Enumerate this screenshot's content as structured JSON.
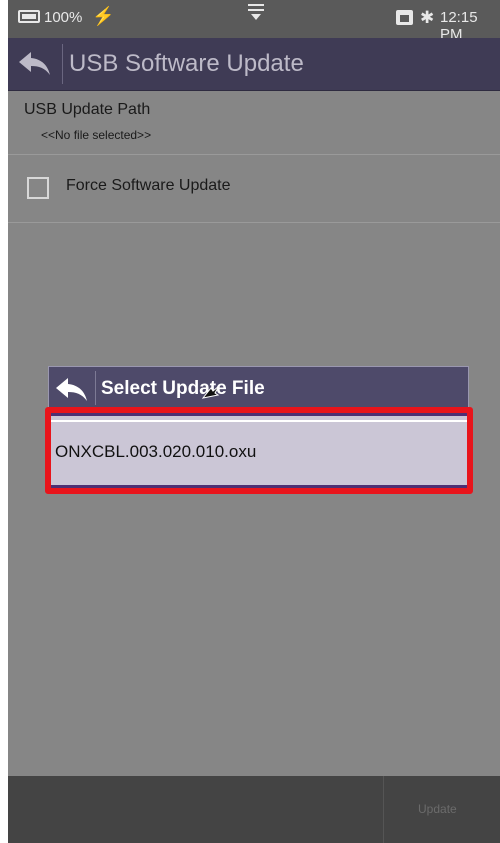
{
  "status_bar": {
    "battery_percent": "100%",
    "time": "12:15 PM"
  },
  "header": {
    "title": "USB Software Update"
  },
  "settings": {
    "path_label": "USB Update Path",
    "path_value": "<<No file selected>>",
    "force_update_label": "Force Software Update",
    "force_update_checked": false
  },
  "dialog": {
    "title": "Select Update File",
    "files": [
      "ONXCBL.003.020.010.oxu"
    ]
  },
  "bottom_bar": {
    "update_label": "Update"
  },
  "colors": {
    "header_bg": "#3f3b55",
    "dialog_header_bg": "#4e4a6a",
    "selection_bg": "#cbc6d6",
    "highlight": "#e8141b"
  }
}
